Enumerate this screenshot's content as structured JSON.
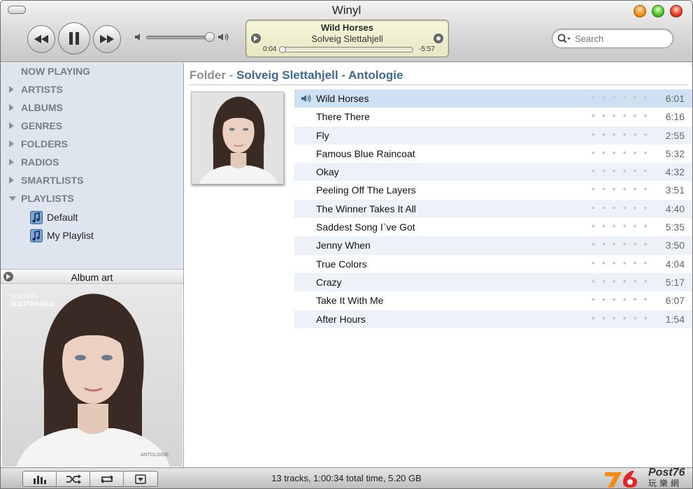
{
  "window": {
    "title": "Winyl"
  },
  "player": {
    "prev_icon": "previous-icon",
    "pause_icon": "pause-icon",
    "next_icon": "next-icon",
    "volume_level": 0.88,
    "now_title": "Wild Horses",
    "now_artist": "Solveig Slettahjell",
    "elapsed": "0:04",
    "remaining": "-5:57",
    "progress": 0.011
  },
  "search": {
    "placeholder": "Search"
  },
  "sidebar": {
    "items": [
      {
        "label": "NOW PLAYING",
        "expander": "none"
      },
      {
        "label": "ARTISTS",
        "expander": "collapsed"
      },
      {
        "label": "ALBUMS",
        "expander": "collapsed"
      },
      {
        "label": "GENRES",
        "expander": "collapsed"
      },
      {
        "label": "FOLDERS",
        "expander": "collapsed"
      },
      {
        "label": "RADIOS",
        "expander": "collapsed"
      },
      {
        "label": "SMARTLISTS",
        "expander": "collapsed"
      },
      {
        "label": "PLAYLISTS",
        "expander": "expanded"
      }
    ],
    "playlists": [
      {
        "label": "Default"
      },
      {
        "label": "My Playlist"
      }
    ]
  },
  "album_art": {
    "header": "Album art",
    "cover_artist_line1": "SOLVEIG",
    "cover_artist_line2": "SLETTAHJELL",
    "cover_album": "ANTOLOGIE"
  },
  "content": {
    "header_prefix": "Folder - ",
    "header_path": "Solveig Slettahjell - Antologie",
    "tracks": [
      {
        "title": "Wild Horses",
        "duration": "6:01",
        "playing": true
      },
      {
        "title": "There There",
        "duration": "6:16"
      },
      {
        "title": "Fly",
        "duration": "2:55"
      },
      {
        "title": "Famous Blue Raincoat",
        "duration": "5:32"
      },
      {
        "title": "Okay",
        "duration": "4:32"
      },
      {
        "title": "Peeling Off The Layers",
        "duration": "3:51"
      },
      {
        "title": "The Winner Takes It All",
        "duration": "4:40"
      },
      {
        "title": "Saddest Song I`ve Got",
        "duration": "5:35"
      },
      {
        "title": "Jenny When",
        "duration": "3:50"
      },
      {
        "title": "True Colors",
        "duration": "4:04"
      },
      {
        "title": "Crazy",
        "duration": "5:17"
      },
      {
        "title": "Take It With Me",
        "duration": "6:07"
      },
      {
        "title": "After Hours",
        "duration": "1:54"
      }
    ],
    "rating_dots": "••••••"
  },
  "status": {
    "summary": "13 tracks, 1:00:34 total time, 5.20 GB",
    "buttons": [
      "equalizer-icon",
      "shuffle-icon",
      "repeat-icon",
      "menu-down-icon"
    ],
    "logo_text": "Post76",
    "logo_sub": "玩樂網"
  },
  "colors": {
    "header_blue": "#3e6a92",
    "sidebar_bg": "#dfe5ee",
    "row_alt": "#edf2f9",
    "row_playing": "#cfe0f2"
  }
}
